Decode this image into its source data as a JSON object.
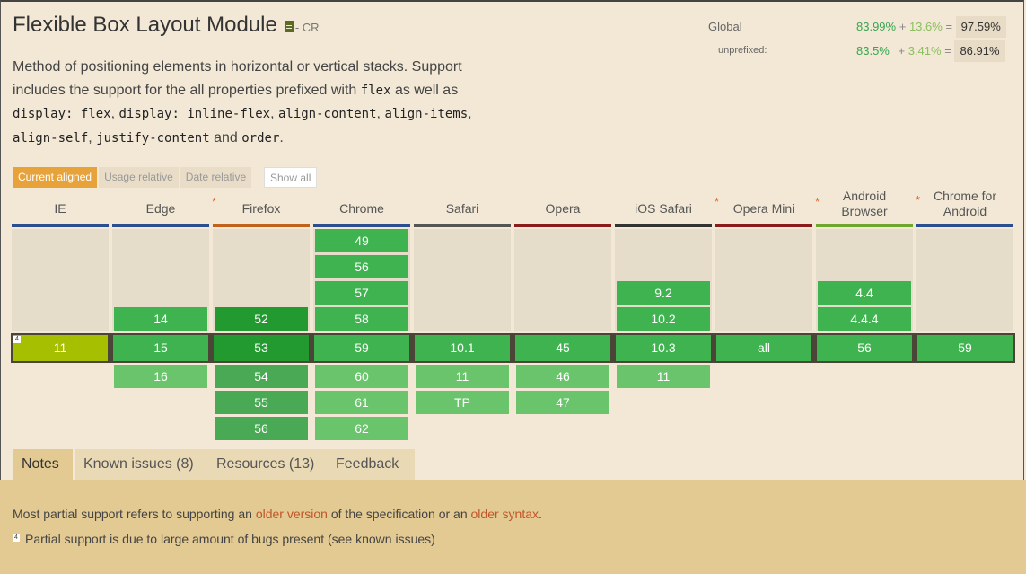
{
  "feature": {
    "title": "Flexible Box Layout Module",
    "status": "- CR",
    "description": {
      "intro": "Method of positioning elements in horizontal or vertical stacks. Support includes the support for the all properties prefixed with",
      "code_flex": "flex",
      "as_well_as": "as well as",
      "code_display_flex": "display: flex",
      "code_inline_flex": "display: inline-flex",
      "code_align_content": "align-content",
      "code_align_items": "align-items",
      "code_align_self": "align-self",
      "code_justify": "justify-content",
      "and": "and",
      "code_order": "order",
      "sep": ",",
      "end": "."
    }
  },
  "stats": {
    "global_label": "Global",
    "global_supported": "83.99%",
    "global_plus": "+",
    "global_partial": "13.6%",
    "global_eq": "=",
    "global_total": "97.59%",
    "unprefixed_label": "unprefixed:",
    "unprefixed_supported": "83.5%",
    "unprefixed_plus": "+",
    "unprefixed_partial": "3.41%",
    "unprefixed_eq": "=",
    "unprefixed_total": "86.91%"
  },
  "filters": {
    "current_aligned": "Current aligned",
    "usage_relative": "Usage relative",
    "date_relative": "Date relative",
    "show_all": "Show all"
  },
  "browsers": [
    {
      "name": "IE",
      "bar": "#2a4e8f",
      "star": ""
    },
    {
      "name": "Edge",
      "bar": "#2a4e8f",
      "star": "*"
    },
    {
      "name": "Firefox",
      "bar": "#c0621b",
      "star": ""
    },
    {
      "name": "Chrome",
      "bar": "#2a4e8f",
      "star": ""
    },
    {
      "name": "Safari",
      "bar": "#555555",
      "star": ""
    },
    {
      "name": "Opera",
      "bar": "#8a1c1c",
      "star": ""
    },
    {
      "name": "iOS Safari",
      "bar": "#333333",
      "star": "*"
    },
    {
      "name": "Opera Mini",
      "bar": "#8a1c1c",
      "star": "*"
    },
    {
      "name": "Android\nBrowser",
      "bar": "#6ea62e",
      "star": "*"
    },
    {
      "name": "Chrome for\nAndroid",
      "bar": "#2a4e8f",
      "star": ""
    }
  ],
  "versions": {
    "past": [
      [],
      [
        "14"
      ],
      [
        "52"
      ],
      [
        "49",
        "56",
        "57",
        "58"
      ],
      [],
      [],
      [
        "9.2",
        "10.2"
      ],
      [],
      [
        "4.4",
        "4.4.4"
      ],
      []
    ],
    "current": [
      "11",
      "15",
      "53",
      "59",
      "10.1",
      "45",
      "10.3",
      "all",
      "56",
      "59"
    ],
    "future": [
      [],
      [
        "16"
      ],
      [
        "54",
        "55",
        "56"
      ],
      [
        "60",
        "61",
        "62"
      ],
      [
        "11",
        "TP"
      ],
      [
        "46",
        "47"
      ],
      [
        "11"
      ],
      [],
      [],
      []
    ]
  },
  "note_marker": "4",
  "tabs": [
    "Notes",
    "Known issues (8)",
    "Resources (13)",
    "Feedback"
  ],
  "notes": {
    "line1_a": "Most partial support refers to supporting an",
    "line1_link1": "older version",
    "line1_b": "of the specification or an",
    "line1_link2": "older syntax",
    "line1_c": ".",
    "footnote_num": "4",
    "line2": "Partial support is due to large amount of bugs present (see known issues)"
  }
}
